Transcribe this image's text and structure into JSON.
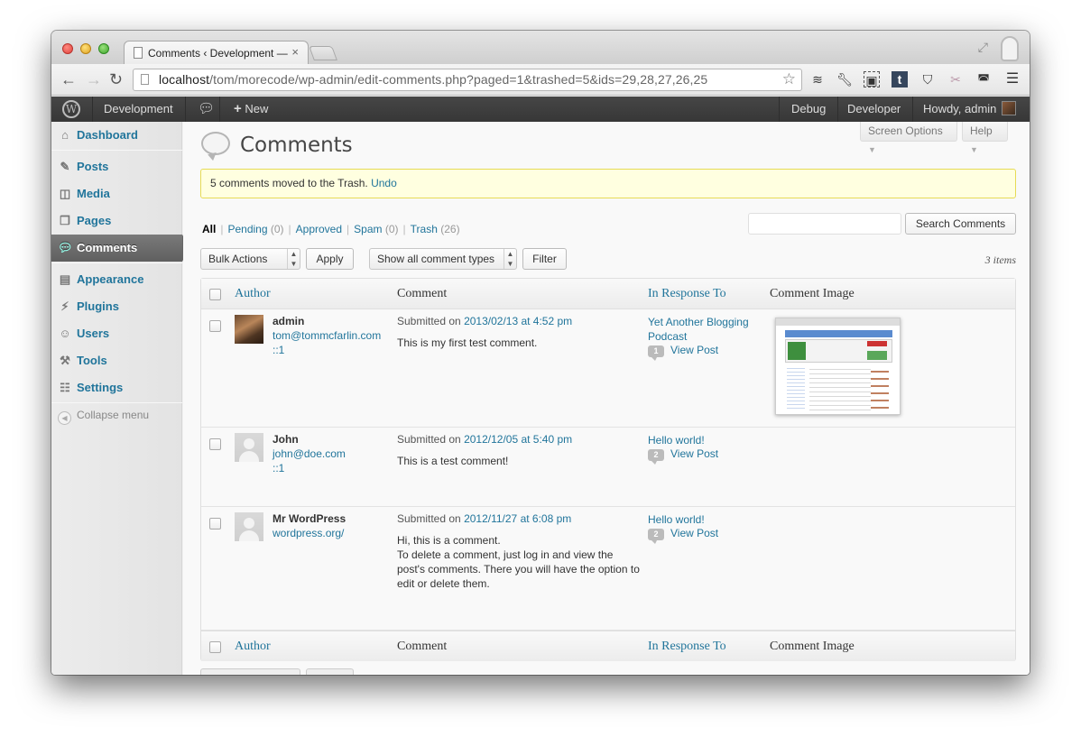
{
  "browser": {
    "tab_title": "Comments ‹ Development —",
    "tab_close": "×",
    "url_host": "localhost",
    "url_path": "/tom/morecode/wp-admin/edit-comments.php?paged=1&trashed=5&ids=29,28,27,26,25",
    "extensions": [
      "layers-icon",
      "wrench-icon",
      "evernote-icon",
      "tumblr-icon",
      "pocket-icon",
      "scissors-icon",
      "disguise-icon",
      "menu-icon"
    ]
  },
  "adminbar": {
    "site_name": "Development",
    "new_label": "New",
    "debug": "Debug",
    "developer": "Developer",
    "howdy": "Howdy, admin"
  },
  "sidebar": {
    "items": [
      {
        "label": "Dashboard",
        "icon": "house-icon"
      },
      {
        "label": "Posts",
        "icon": "pushpin-icon"
      },
      {
        "label": "Media",
        "icon": "camera-icon"
      },
      {
        "label": "Pages",
        "icon": "pages-icon"
      },
      {
        "label": "Comments",
        "icon": "speech-bubble-icon"
      },
      {
        "label": "Appearance",
        "icon": "appearance-icon"
      },
      {
        "label": "Plugins",
        "icon": "plug-icon"
      },
      {
        "label": "Users",
        "icon": "users-icon"
      },
      {
        "label": "Tools",
        "icon": "tools-icon"
      },
      {
        "label": "Settings",
        "icon": "settings-icon"
      }
    ],
    "collapse": "Collapse menu"
  },
  "screen_options": "Screen Options",
  "help": "Help",
  "page_title": "Comments",
  "notice": {
    "text": "5 comments moved to the Trash.",
    "undo": "Undo"
  },
  "filters": {
    "all": "All",
    "pending": "Pending",
    "pending_count": "(0)",
    "approved": "Approved",
    "spam": "Spam",
    "spam_count": "(0)",
    "trash": "Trash",
    "trash_count": "(26)"
  },
  "search_button": "Search Comments",
  "bulk_actions": "Bulk Actions",
  "apply": "Apply",
  "comment_types": "Show all comment types",
  "filter": "Filter",
  "items_count": "3 items",
  "columns": {
    "author": "Author",
    "comment": "Comment",
    "in_response_to": "In Response To",
    "comment_image": "Comment Image"
  },
  "comments": [
    {
      "author": "admin",
      "email": "tom@tommcfarlin.com",
      "ip": "::1",
      "submitted_prefix": "Submitted on",
      "date": "2013/02/13 at 4:52 pm",
      "text": [
        "This is my first test comment."
      ],
      "post_title": "Yet Another Blogging Podcast",
      "post_count": "1",
      "view_post": "View Post"
    },
    {
      "author": "John",
      "email": "john@doe.com",
      "ip": "::1",
      "submitted_prefix": "Submitted on",
      "date": "2012/12/05 at 5:40 pm",
      "text": [
        "This is a test comment!"
      ],
      "post_title": "Hello world!",
      "post_count": "2",
      "view_post": "View Post"
    },
    {
      "author": "Mr WordPress",
      "email": "wordpress.org/",
      "ip": "",
      "submitted_prefix": "Submitted on",
      "date": "2012/11/27 at 6:08 pm",
      "text": [
        "Hi, this is a comment.",
        "To delete a comment, just log in and view the post's comments. There you will have the option to edit or delete them."
      ],
      "post_title": "Hello world!",
      "post_count": "2",
      "view_post": "View Post"
    }
  ]
}
